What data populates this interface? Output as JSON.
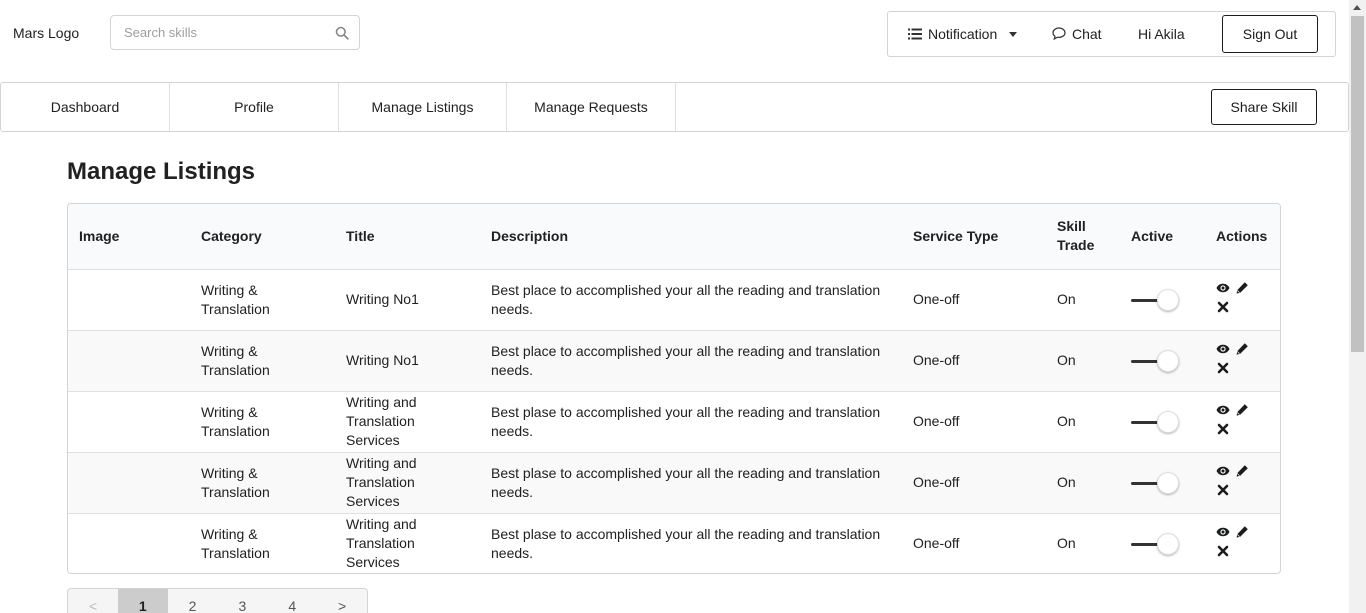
{
  "header": {
    "logo": "Mars Logo",
    "search_placeholder": "Search skills",
    "notification_label": "Notification",
    "chat_label": "Chat",
    "greeting": "Hi Akila",
    "signout_label": "Sign Out"
  },
  "nav": {
    "tabs": [
      {
        "label": "Dashboard"
      },
      {
        "label": "Profile"
      },
      {
        "label": "Manage Listings"
      },
      {
        "label": "Manage Requests"
      }
    ],
    "share_label": "Share Skill"
  },
  "page_title": "Manage Listings",
  "table": {
    "columns": [
      "Image",
      "Category",
      "Title",
      "Description",
      "Service Type",
      "Skill Trade",
      "Active",
      "Actions"
    ],
    "rows": [
      {
        "category": "Writing & Translation",
        "title": "Writing No1",
        "description": "Best place to accomplished your all the reading and translation needs.",
        "service_type": "One-off",
        "skill_trade": "On",
        "active": true
      },
      {
        "category": "Writing & Translation",
        "title": "Writing No1",
        "description": "Best place to accomplished your all the reading and translation needs.",
        "service_type": "One-off",
        "skill_trade": "On",
        "active": true
      },
      {
        "category": "Writing & Translation",
        "title": "Writing and Translation Services",
        "description": "Best plase to accomplished your all the reading and translation needs.",
        "service_type": "One-off",
        "skill_trade": "On",
        "active": true
      },
      {
        "category": "Writing & Translation",
        "title": "Writing and Translation Services",
        "description": "Best plase to accomplished your all the reading and translation needs.",
        "service_type": "One-off",
        "skill_trade": "On",
        "active": true
      },
      {
        "category": "Writing & Translation",
        "title": "Writing and Translation Services",
        "description": "Best plase to accomplished your all the reading and translation needs.",
        "service_type": "One-off",
        "skill_trade": "On",
        "active": true
      }
    ]
  },
  "pagination": {
    "prev": "<",
    "pages": [
      "1",
      "2",
      "3",
      "4"
    ],
    "next": ">",
    "current": "1"
  },
  "icons": {
    "search": "search-icon",
    "notification": "list-icon",
    "chat": "chat-bubble-icon",
    "view": "eye-icon",
    "edit": "pencil-icon",
    "delete": "close-icon"
  }
}
